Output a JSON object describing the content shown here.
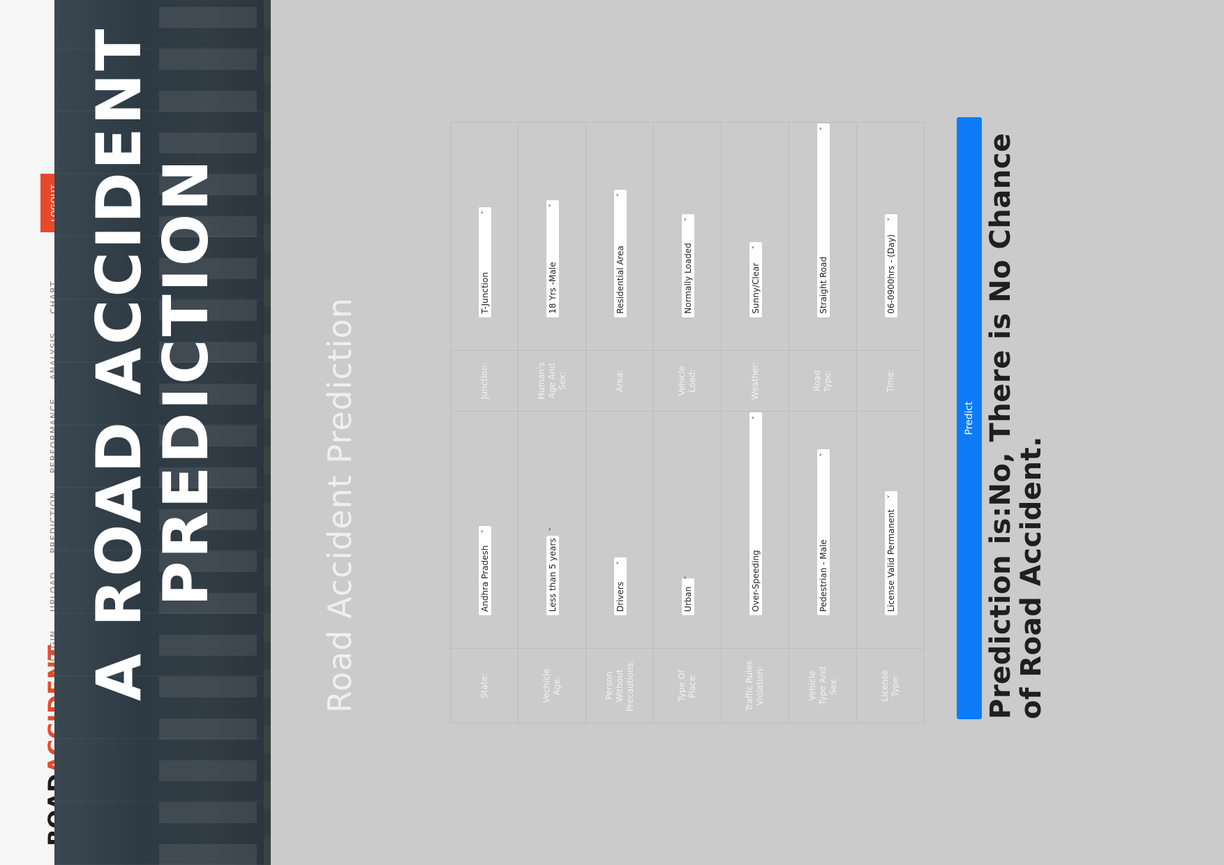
{
  "brand": {
    "part1": "ROAD",
    "part2": "ACCIDENT"
  },
  "nav": {
    "items": [
      "Login",
      "Upload",
      "Prediction",
      "Performance",
      "Analysis",
      "Chart"
    ],
    "logout": "LOGOUT"
  },
  "hero": {
    "line1": "A ROAD ACCIDENT",
    "line2": "PREDICTION"
  },
  "page_title": "Road Accident Prediction",
  "form": {
    "rows": [
      {
        "label1": "State:",
        "value1": "Andhra Pradesh",
        "label2": "Junction:",
        "value2": "T-Junction"
      },
      {
        "label1": "Vechicle Age:",
        "value1": "Less than 5 years",
        "label2": "Human's Age And Sex:",
        "value2": "18 Yrs -Male"
      },
      {
        "label1": "Person Without Precautions:",
        "value1": "Drivers",
        "label2": "Area:",
        "value2": "Residential Area"
      },
      {
        "label1": "Type Of Place:",
        "value1": "Urban",
        "label2": "Vehicle Load:",
        "value2": "Normally Loaded"
      },
      {
        "label1": "Traffic Rules Violation:",
        "value1": "Over-Speeding",
        "label2": "Weather:",
        "value2": "Sunny/Clear"
      },
      {
        "label1": "Vehicle Type And Sex:",
        "value1": "Pedestrian - Male",
        "label2": "Road Type:",
        "value2": "Straight Road"
      },
      {
        "label1": "License Type:",
        "value1": "License Valid Permanent",
        "label2": "Time:",
        "value2": "06-0900hrs - (Day)"
      }
    ]
  },
  "predict_label": "Predict",
  "result": "Prediction is:No, There is No Chance of Road Accident.",
  "icons": {
    "select_chevron": "chevron-down-icon"
  },
  "colors": {
    "accent": "#e9492b",
    "primary": "#0d7bf8",
    "background": "#cbcbcb"
  }
}
